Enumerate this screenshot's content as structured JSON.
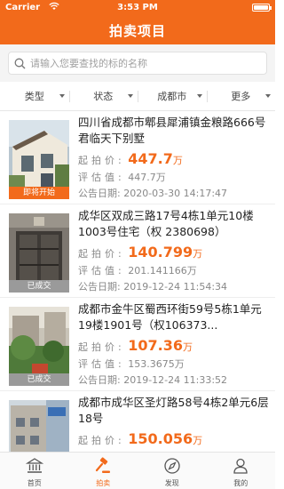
{
  "status_bar": {
    "carrier": "Carrier",
    "time": "3:53 PM"
  },
  "header": {
    "title": "拍卖项目"
  },
  "search": {
    "placeholder": "请输入您要查找的标的名称"
  },
  "filters": [
    {
      "label": "类型"
    },
    {
      "label": "状态"
    },
    {
      "label": "成都市"
    },
    {
      "label": "更多"
    }
  ],
  "labels": {
    "start_price": "起拍价:",
    "appraisal": "评估值:",
    "announce_date": "公告日期:"
  },
  "items": [
    {
      "title": "四川省成都市郫县犀浦镇金粮路666号君临天下别墅",
      "start_price": "447.7",
      "start_unit": "万",
      "appraisal": "447.7万",
      "date": "2020-03-30 14:17:47",
      "badge": "即将开始",
      "badge_state": "upcoming"
    },
    {
      "title": "成华区双成三路17号4栋1单元10楼1003号住宅（权 2380698）",
      "start_price": "140.799",
      "start_unit": "万",
      "appraisal": "201.141166万",
      "date": "2019-12-24 11:54:34",
      "badge": "已成交",
      "badge_state": "done"
    },
    {
      "title": "成都市金牛区蜀西环街59号5栋1单元19楼1901号（权106373...",
      "start_price": "107.36",
      "start_unit": "万",
      "appraisal": "153.3675万",
      "date": "2019-12-24 11:33:52",
      "badge": "已成交",
      "badge_state": "done"
    },
    {
      "title": "成都市成华区圣灯路58号4栋2单元6层18号",
      "start_price": "150.056",
      "start_unit": "万",
      "appraisal": "",
      "date": "",
      "badge": "",
      "badge_state": ""
    }
  ],
  "tabbar": [
    {
      "label": "首页",
      "icon": "bank-icon"
    },
    {
      "label": "拍卖",
      "icon": "gavel-icon",
      "active": true
    },
    {
      "label": "发现",
      "icon": "compass-icon"
    },
    {
      "label": "我的",
      "icon": "user-icon"
    }
  ],
  "colors": {
    "accent": "#f26a1b",
    "badge_done": "#9a9a9a"
  }
}
